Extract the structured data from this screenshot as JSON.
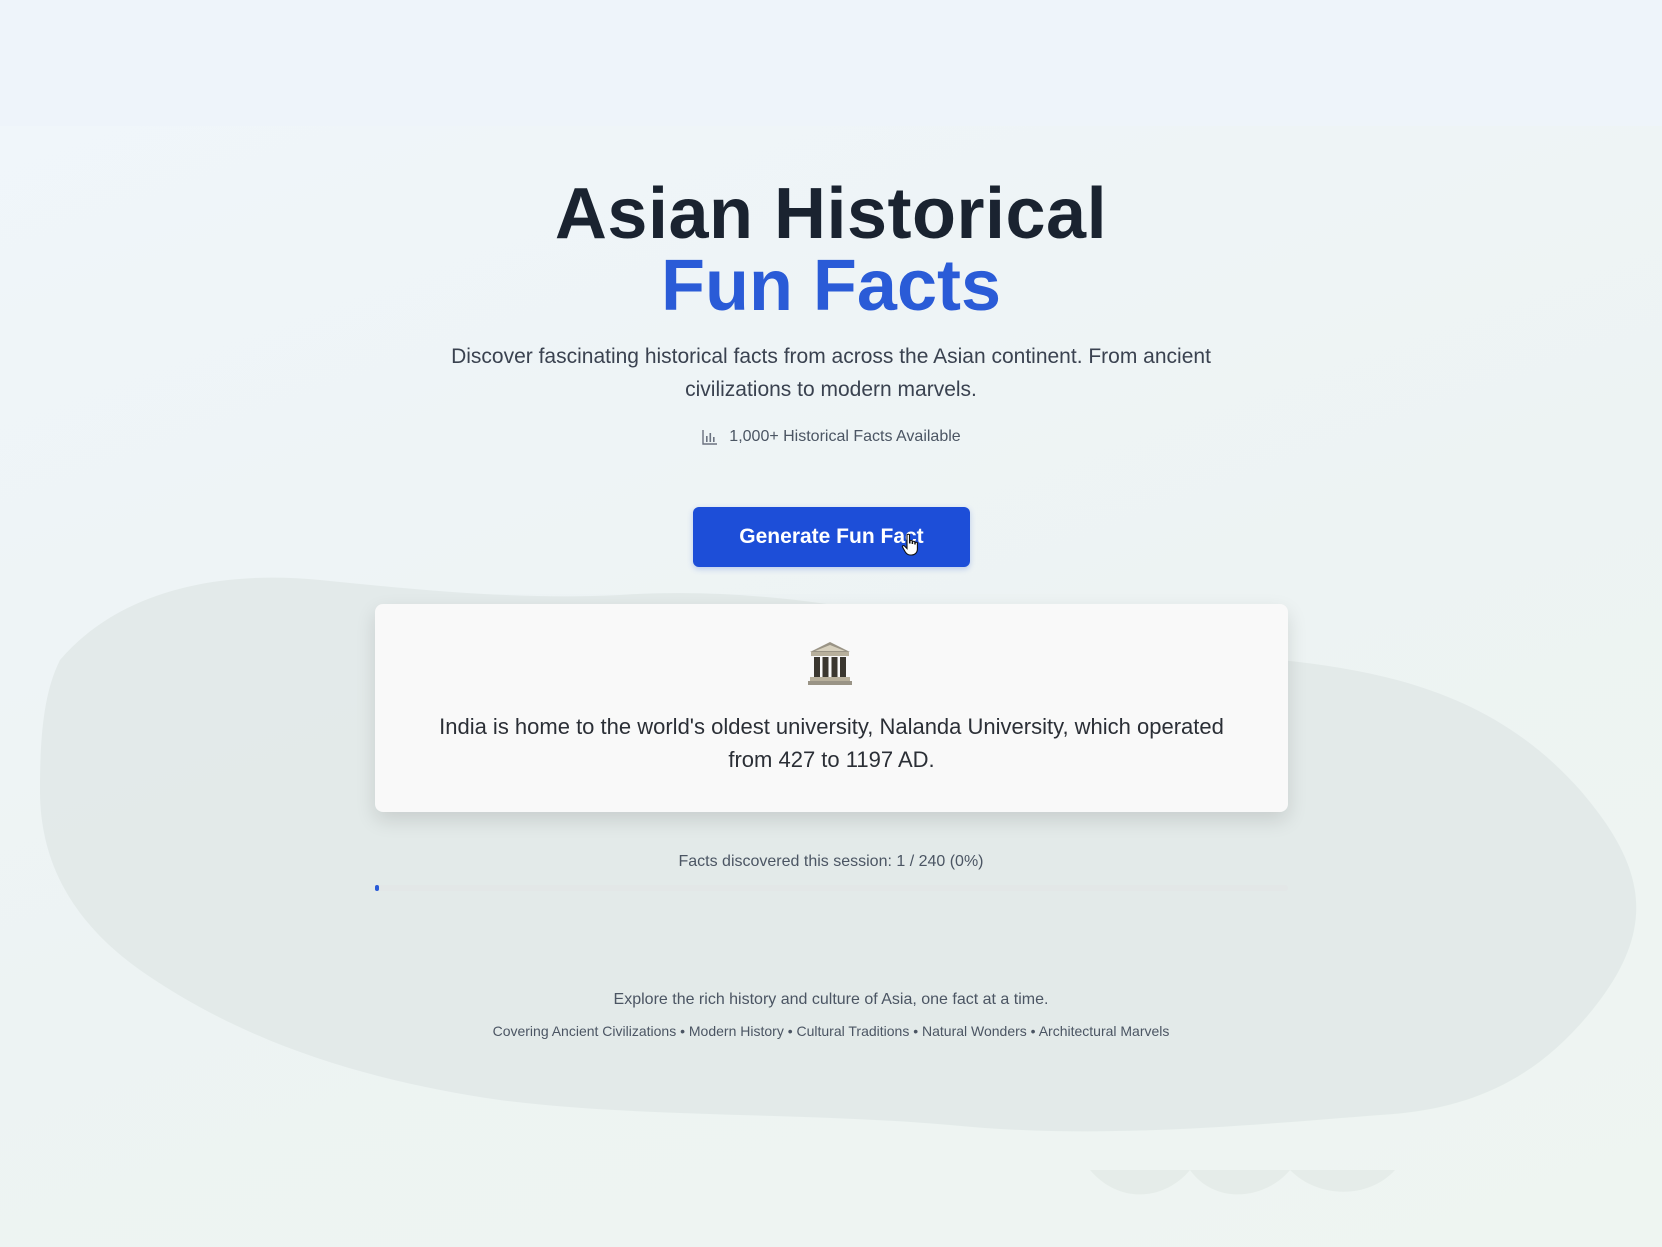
{
  "hero": {
    "title_line1": "Asian Historical",
    "title_line2": "Fun Facts",
    "subtitle": "Discover fascinating historical facts from across the Asian continent. From ancient civilizations to modern marvels.",
    "fact_count_label": "1,000+ Historical Facts Available",
    "fact_count_icon": "bar-chart-icon"
  },
  "actions": {
    "generate_label": "Generate Fun Fact"
  },
  "fact": {
    "icon": "classical-building-icon",
    "text": "India is home to the world's oldest university, Nalanda University, which operated from 427 to 1197 AD."
  },
  "progress": {
    "label": "Facts discovered this session: 1 / 240 (0%)",
    "discovered": 1,
    "total": 240,
    "percent": 0
  },
  "footer": {
    "tagline": "Explore the rich history and culture of Asia, one fact at a time.",
    "topics": "Covering Ancient Civilizations • Modern History • Cultural Traditions • Natural Wonders • Architectural Marvels"
  },
  "colors": {
    "accent": "#2a5bd7",
    "button": "#1d4ed8",
    "title": "#1a2330",
    "background": "#eef4f6"
  }
}
